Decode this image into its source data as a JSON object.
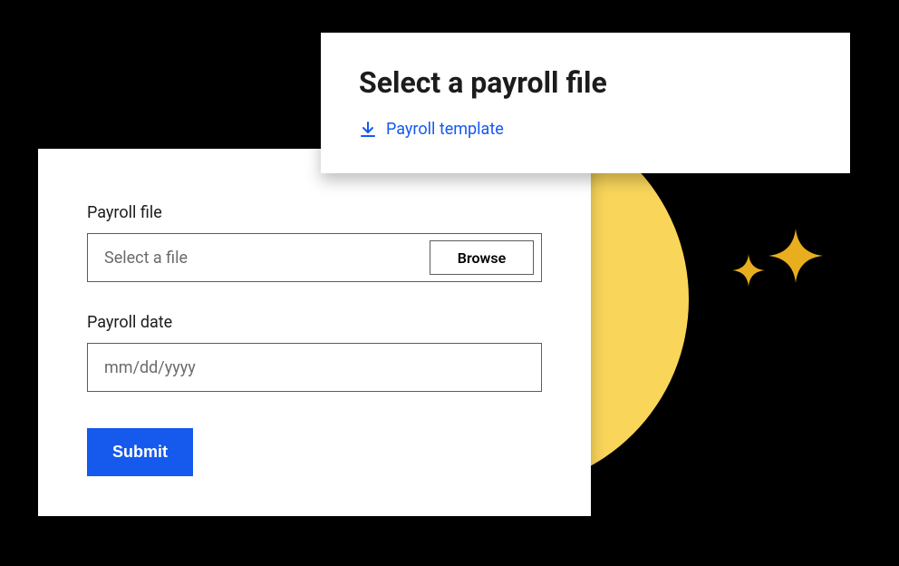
{
  "topCard": {
    "title": "Select a payroll file",
    "downloadLink": "Payroll template"
  },
  "formCard": {
    "fileLabel": "Payroll file",
    "filePlaceholder": "Select a file",
    "browseLabel": "Browse",
    "dateLabel": "Payroll date",
    "datePlaceholder": "mm/dd/yyyy",
    "submitLabel": "Submit"
  },
  "colors": {
    "accent": "#1559ed",
    "yellow": "#F9D55A"
  }
}
